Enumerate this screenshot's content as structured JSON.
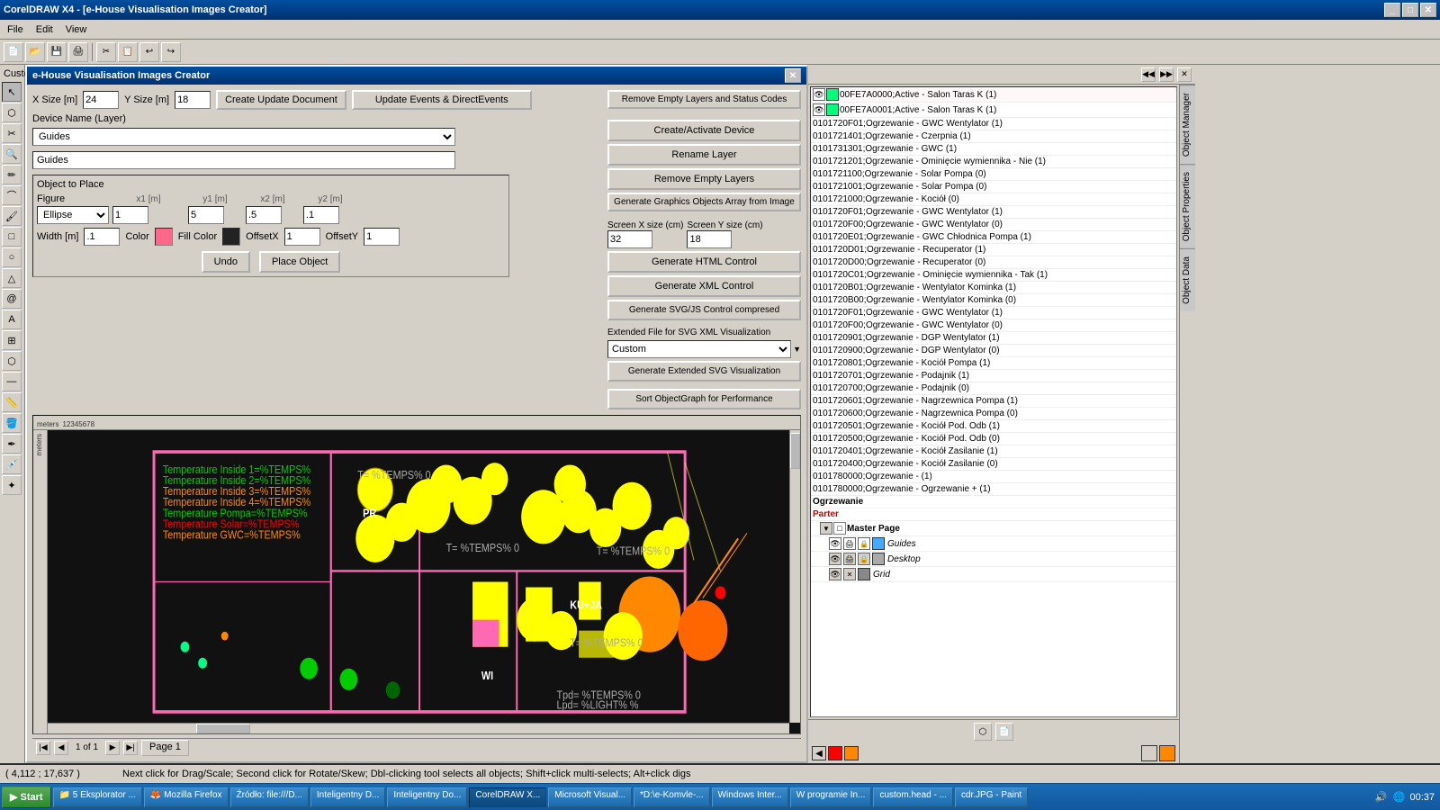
{
  "window": {
    "coreldraw_title": "CorelDRAW X4 - [e-House Visualisation Images Creator]",
    "plugin_title": "e-House Visualisation Images Creator",
    "close_symbol": "✕",
    "minimize_symbol": "_",
    "maximize_symbol": "□"
  },
  "menu": {
    "items": [
      "File",
      "Edit",
      "View"
    ]
  },
  "left_label": "Custom",
  "plugin": {
    "size_labels": {
      "x": "X Size [m]",
      "y": "Y Size [m]"
    },
    "size_x": "24",
    "size_y": "18",
    "create_btn": "Create Update Document",
    "update_btn": "Update Events & DirectEvents",
    "remove_status_btn": "Remove Empty Layers and Status Codes",
    "device_label": "Device Name (Layer)",
    "device_option": "Guides",
    "device_text": "Guides",
    "create_device_btn": "Create/Activate Device",
    "rename_btn": "Rename Layer",
    "remove_empty_btn": "Remove Empty Layers",
    "gen_graphics_btn": "Generate Graphics Objects Array from Image",
    "sort_btn": "Sort ObjectGraph for Performance",
    "screen_x_label": "Screen X size (cm)",
    "screen_y_label": "Screen Y size (cm)",
    "screen_x": "32",
    "screen_y": "18",
    "gen_html_btn": "Generate HTML Control",
    "gen_xml_btn": "Generate XML Control",
    "gen_svg_btn": "Generate SVG/JS Control compresed",
    "ext_label": "Extended File for SVG XML Visualization",
    "ext_option": "Custom",
    "gen_ext_btn": "Generate Extended SVG Visualization",
    "object_to_place": "Object to Place",
    "figure_label": "Figure",
    "figure_option": "Ellipse",
    "col_x1": "x1 [m]",
    "col_y1": "y1 [m]",
    "col_x2": "x2 [m]",
    "col_y2": "y2 [m]",
    "x1_val": "1",
    "y1_val": "5",
    "x2_val": ".5",
    "y2_val": ".1",
    "width_label": "Width [m]",
    "width_val": ".1",
    "color_label": "Color",
    "fill_label": "Fill Color",
    "offsetx_label": "OffsetX",
    "offsety_label": "OffsetY",
    "offsetx_val": "1",
    "offsety_val": "1",
    "color_btn": "Color",
    "undo_btn": "Undo",
    "place_btn": "Place Object"
  },
  "object_manager": {
    "header": "Object Manager",
    "tabs": [
      "Object Manager",
      "Object Properties",
      "Object Data"
    ],
    "items": [
      {
        "indent": 0,
        "text": "00FE7A0000;Active - Salon Taras K (1)",
        "color": "#00FE7A"
      },
      {
        "indent": 0,
        "text": "00FE7A0001;Active - Salon Taras K (1)",
        "color": "#00FE7A"
      },
      {
        "indent": 0,
        "text": "0101720F01;Ogrzewanie - GWC Wentylator (1)",
        "color": null
      },
      {
        "indent": 0,
        "text": "0101721401;Ogrzewanie - Czerpnia (1)",
        "color": null
      },
      {
        "indent": 0,
        "text": "0101731301;Ogrzewanie - GWC (1)",
        "color": null
      },
      {
        "indent": 0,
        "text": "0101721201;Ogrzewanie - Ominiecie wymiennika - Nie (1)",
        "color": null
      },
      {
        "indent": 0,
        "text": "0101721100;Ogrzewanie - Solar Pompa (0)",
        "color": null
      },
      {
        "indent": 0,
        "text": "0101721001;Ogrzewanie - Solar Pompa (0)",
        "color": null
      },
      {
        "indent": 0,
        "text": "0101721000;Ogrzewanie - Kociol (0)",
        "color": null
      },
      {
        "indent": 0,
        "text": "0101720F01;Ogrzewanie - GWC Wentylator (1)",
        "color": null
      },
      {
        "indent": 0,
        "text": "0101720F00;Ogrzewanie - GWC Wentylator (0)",
        "color": null
      },
      {
        "indent": 0,
        "text": "0101720E01;Ogrzewanie - GWC Chłodnica Pompa (1)",
        "color": null
      },
      {
        "indent": 0,
        "text": "0101720D01;Ogrzewanie - Recuperator (1)",
        "color": null
      },
      {
        "indent": 0,
        "text": "0101720D00;Ogrzewanie - Recuperator (0)",
        "color": null
      },
      {
        "indent": 0,
        "text": "0101720C01;Ogrzewanie - Ominięcie wymiennika - Tak (1)",
        "color": null
      },
      {
        "indent": 0,
        "text": "0101720B01;Ogrzewanie - Wentylator Kominka (1)",
        "color": null
      },
      {
        "indent": 0,
        "text": "0101720B00;Ogrzewanie - Wentylator Kominka (0)",
        "color": null
      },
      {
        "indent": 0,
        "text": "0101720F01;Ogrzewanie - GWC Wentylator (1)",
        "color": null
      },
      {
        "indent": 0,
        "text": "0101720F00;Ogrzewanie - GWC Wentylator (0)",
        "color": null
      },
      {
        "indent": 0,
        "text": "0101720901;Ogrzewanie - DGP Wentylator (1)",
        "color": null
      },
      {
        "indent": 0,
        "text": "0101720900;Ogrzewanie - DGP Wentylator (0)",
        "color": null
      },
      {
        "indent": 0,
        "text": "0101720801;Ogrzewanie - Kociół Pompa (1)",
        "color": null
      },
      {
        "indent": 0,
        "text": "0101720701;Ogrzewanie - Podajnik (1)",
        "color": null
      },
      {
        "indent": 0,
        "text": "0101720700;Ogrzewanie - Podajnik (0)",
        "color": null
      },
      {
        "indent": 0,
        "text": "0101720601;Ogrzewanie - Nagrzewnica Pompa (1)",
        "color": null
      },
      {
        "indent": 0,
        "text": "0101720600;Ogrzewanie - Nagrzewnica Pompa (0)",
        "color": null
      },
      {
        "indent": 0,
        "text": "0101720501;Ogrzewanie - Kociół Pod. Odb (1)",
        "color": null
      },
      {
        "indent": 0,
        "text": "0101720500;Ogrzewanie - Kociół Pod. Odb (0)",
        "color": null
      },
      {
        "indent": 0,
        "text": "0101720401;Ogrzewanie - Kociół Zasilanie (1)",
        "color": null
      },
      {
        "indent": 0,
        "text": "0101720400;Ogrzewanie - Kociół Zasilanie (0)",
        "color": null
      },
      {
        "indent": 0,
        "text": "0101780000;Ogrzewanie - (1)",
        "color": null
      },
      {
        "indent": 0,
        "text": "0101780000;Ogrzewanie - Ogrzewanie + (1)",
        "color": null
      },
      {
        "indent": 0,
        "text": "Ogrzewanie",
        "color": null,
        "bold": true
      },
      {
        "indent": 0,
        "text": "Parter",
        "color": "#cc0000",
        "bold": true,
        "red": true
      },
      {
        "indent": 1,
        "text": "Master Page",
        "color": null,
        "bold": true
      },
      {
        "indent": 2,
        "text": "Guides",
        "color": null,
        "italic": true
      },
      {
        "indent": 2,
        "text": "Desktop",
        "color": null,
        "italic": true
      },
      {
        "indent": 2,
        "text": "Grid",
        "color": null,
        "italic": true
      }
    ]
  },
  "page_controls": {
    "page_text": "1 of 1",
    "page_name": "Page 1"
  },
  "status": {
    "coords": "( 4,112 ; 17,637 )",
    "hint": "Next click for Drag/Scale; Second click for Rotate/Skew; Dbl-clicking tool selects all objects; Shift+click multi-selects; Alt+click digs"
  },
  "taskbar": {
    "time": "00:37",
    "items": [
      {
        "label": "Start",
        "is_start": true
      },
      {
        "label": "5 Eksplorator ...",
        "active": false
      },
      {
        "label": "Mozilla Firefox",
        "active": false
      },
      {
        "label": "Źródło: file:///D...",
        "active": false
      },
      {
        "label": "Inteligentny D...",
        "active": false
      },
      {
        "label": "Inteligentny Do...",
        "active": false
      },
      {
        "label": "CorelDRAW X...",
        "active": true
      },
      {
        "label": "Microsoft Visual...",
        "active": false
      },
      {
        "label": "*D:\\e-Komvle-...",
        "active": false
      },
      {
        "label": "Windows Inter...",
        "active": false
      },
      {
        "label": "W programie In...",
        "active": false
      },
      {
        "label": "custom.head - ...",
        "active": false
      },
      {
        "label": "cdr.JPG - Paint",
        "active": false
      }
    ]
  }
}
